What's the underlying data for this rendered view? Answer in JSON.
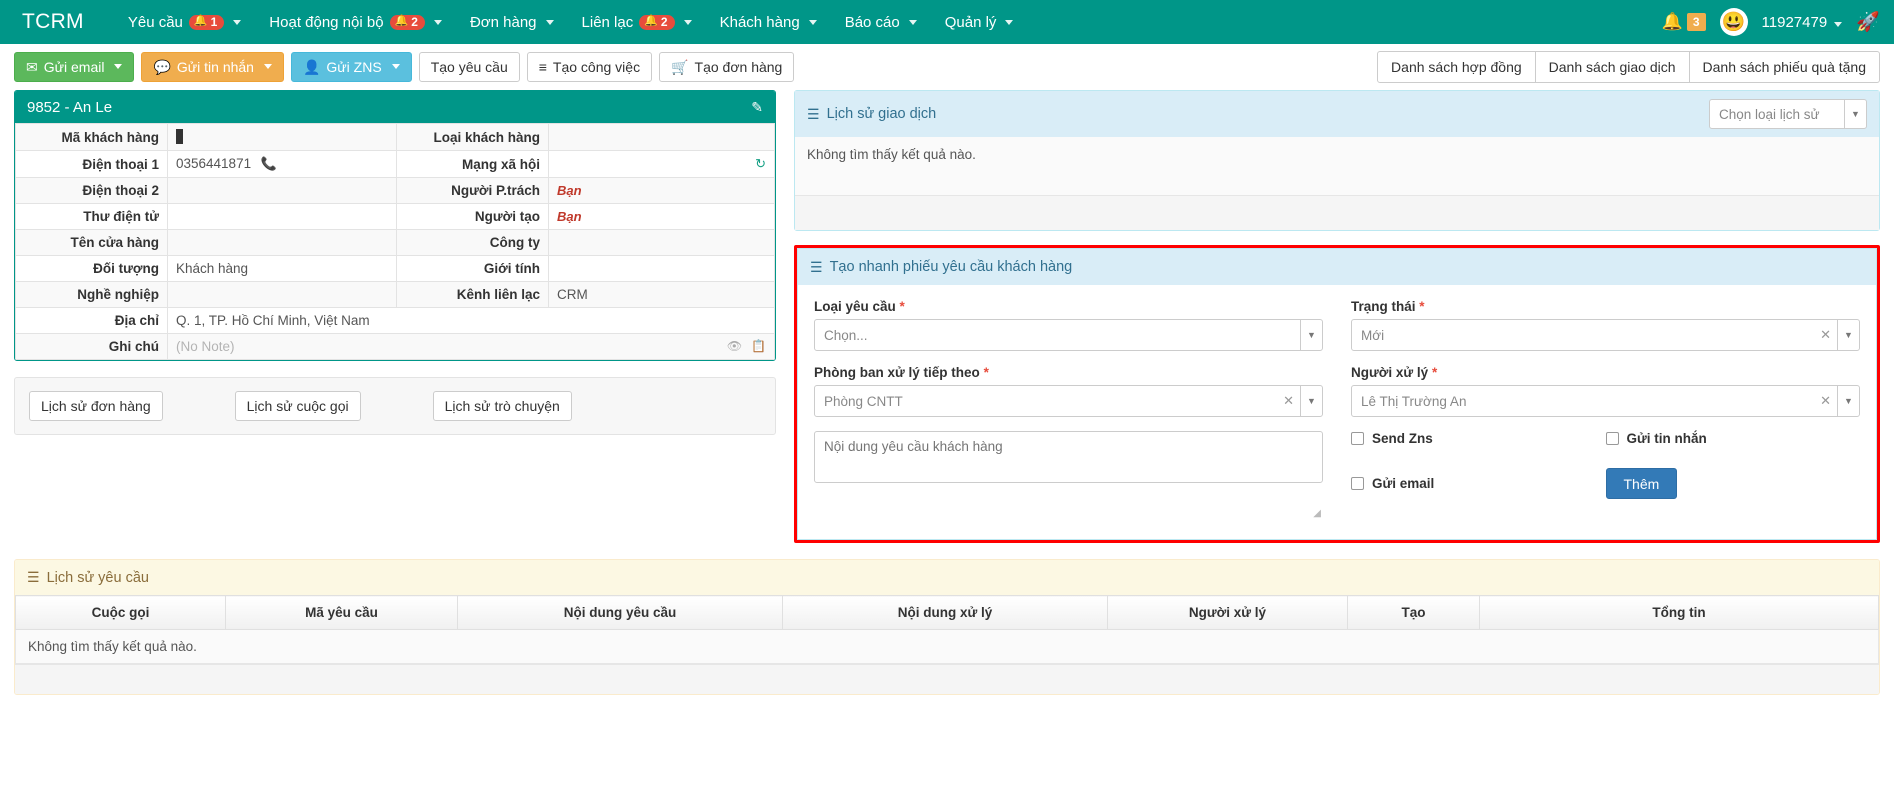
{
  "navbar": {
    "brand": "TCRM",
    "items": [
      {
        "label": "Yêu cầu",
        "badge": "1",
        "caret": true
      },
      {
        "label": "Hoạt động nội bộ",
        "badge": "2",
        "caret": true
      },
      {
        "label": "Đơn hàng",
        "badge": "",
        "caret": true
      },
      {
        "label": "Liên lạc",
        "badge": "2",
        "caret": true
      },
      {
        "label": "Khách hàng",
        "badge": "",
        "caret": true
      },
      {
        "label": "Báo cáo",
        "badge": "",
        "caret": true
      },
      {
        "label": "Quản lý",
        "badge": "",
        "caret": true
      }
    ],
    "notification_badge": "3",
    "notification_icon": "bell-icon",
    "avatar_icon": "smiley-avatar",
    "user_name": "11927479",
    "rocket_icon": "rocket-icon"
  },
  "toolbar": {
    "left": [
      {
        "label": "Gửi email",
        "icon": "envelope-icon",
        "style": "green",
        "caret": true
      },
      {
        "label": "Gửi tin nhắn",
        "icon": "comment-icon",
        "style": "orange",
        "caret": true
      },
      {
        "label": "Gửi ZNS",
        "icon": "contact-card-icon",
        "style": "blue",
        "caret": true
      },
      {
        "label": "Tạo yêu cầu",
        "icon": "",
        "style": "default",
        "caret": false
      },
      {
        "label": "Tạo công việc",
        "icon": "tasks-icon",
        "style": "default",
        "caret": false
      },
      {
        "label": "Tạo đơn hàng",
        "icon": "cart-icon",
        "style": "default",
        "caret": false
      }
    ],
    "right": [
      {
        "label": "Danh sách hợp đồng"
      },
      {
        "label": "Danh sách giao dịch"
      },
      {
        "label": "Danh sách phiếu quà tặng"
      }
    ]
  },
  "customer_card": {
    "title": "9852 - An Le",
    "edit_icon": "pencil-icon",
    "rows": [
      {
        "label_left": "Mã khách hàng",
        "value_left": "",
        "value_left_cursor": true,
        "label_right": "Loại khách hàng",
        "value_right": ""
      },
      {
        "label_left": "Điện thoại 1",
        "value_left": "0356441871",
        "phone_icon": "phone-icon",
        "label_right": "Mạng xã hội",
        "value_right": "",
        "right_icon": "refresh-icon"
      },
      {
        "label_left": "Điện thoại 2",
        "value_left": "",
        "label_right": "Người P.trách",
        "value_right": "Bạn",
        "right_red": true
      },
      {
        "label_left": "Thư điện tử",
        "value_left": "",
        "label_right": "Người tạo",
        "value_right": "Bạn",
        "right_red": true
      },
      {
        "label_left": "Tên cửa hàng",
        "value_left": "",
        "label_right": "Công ty",
        "value_right": ""
      },
      {
        "label_left": "Đối tượng",
        "value_left": "Khách hàng",
        "label_right": "Giới tính",
        "value_right": ""
      },
      {
        "label_left": "Nghề nghiệp",
        "value_left": "",
        "label_right": "Kênh liên lạc",
        "value_right": "CRM"
      }
    ],
    "address_label": "Địa chỉ",
    "address_value": "Q. 1, TP. Hồ Chí Minh, Việt Nam",
    "note_label": "Ghi chú",
    "note_value": "(No Note)",
    "note_icons": [
      "eye-icon",
      "copy-icon"
    ]
  },
  "history_buttons": [
    {
      "label": "Lịch sử đơn hàng"
    },
    {
      "label": "Lịch sử cuộc gọi"
    },
    {
      "label": "Lịch sử trò chuyện"
    }
  ],
  "transaction_history": {
    "icon": "list-icon",
    "title": "Lịch sử giao dịch",
    "filter_placeholder": "Chọn loại lịch sử",
    "empty_text": "Không tìm thấy kết quả nào."
  },
  "quick_request": {
    "icon": "list-icon",
    "title": "Tạo nhanh phiếu yêu cầu khách hàng",
    "border_color": "#ff0000",
    "fields": {
      "request_type": {
        "label": "Loại yêu cầu",
        "required": true,
        "value": "Chọn...",
        "has_clear": false
      },
      "status": {
        "label": "Trạng thái",
        "required": true,
        "value": "Mới",
        "has_clear": true
      },
      "next_department": {
        "label": "Phòng ban xử lý tiếp theo",
        "required": true,
        "value": "Phòng CNTT",
        "has_clear": true
      },
      "handler": {
        "label": "Người xử lý",
        "required": true,
        "value": "Lê Thị Trường An",
        "has_clear": true
      },
      "content": {
        "placeholder": "Nội dung yêu cầu khách hàng",
        "value": ""
      }
    },
    "checkboxes": [
      {
        "label": "Send Zns",
        "checked": false
      },
      {
        "label": "Gửi tin nhắn",
        "checked": false
      },
      {
        "label": "Gửi email",
        "checked": false
      }
    ],
    "submit_label": "Thêm"
  },
  "request_history": {
    "icon": "list-icon",
    "title": "Lịch sử yêu cầu",
    "columns": [
      "Cuộc gọi",
      "Mã yêu cầu",
      "Nội dung yêu cầu",
      "Nội dung xử lý",
      "Người xử lý",
      "Tạo",
      "Tổng tin"
    ],
    "empty_text": "Không tìm thấy kết quả nào."
  },
  "colors": {
    "brand_teal": "#009688",
    "accent_blue": "#337ab7",
    "alert_red": "#ff0000",
    "panel_blue": "#d9edf7",
    "panel_yellow": "#fcf8e3"
  }
}
